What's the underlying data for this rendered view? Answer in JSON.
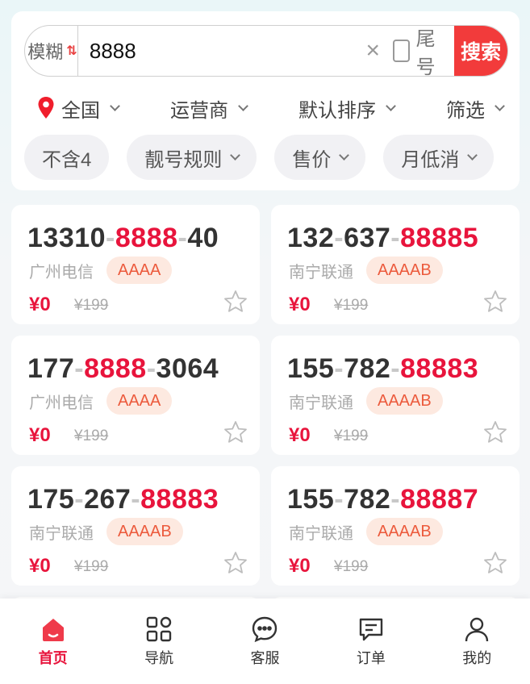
{
  "search": {
    "mode_label": "模糊",
    "swap_glyph": "⇅",
    "value": "8888",
    "clear_glyph": "×",
    "tail_label": "尾号",
    "button_label": "搜索"
  },
  "filters": {
    "region": "全国",
    "carrier": "运营商",
    "sort": "默认排序",
    "screen": "筛选"
  },
  "chips": [
    "不含4",
    "靓号规则",
    "售价",
    "月低消"
  ],
  "numbers": [
    {
      "parts": [
        [
          "13310",
          0
        ],
        [
          "-",
          2
        ],
        [
          "8888",
          1
        ],
        [
          "-",
          2
        ],
        [
          "40",
          0
        ]
      ],
      "location": "广州电信",
      "tag": "AAAA",
      "price": "¥0",
      "original": "¥199"
    },
    {
      "parts": [
        [
          "132",
          0
        ],
        [
          "-",
          2
        ],
        [
          "637",
          0
        ],
        [
          "-",
          2
        ],
        [
          "88885",
          3
        ]
      ],
      "location": "南宁联通",
      "tag": "AAAAB",
      "price": "¥0",
      "original": "¥199"
    },
    {
      "parts": [
        [
          "177",
          0
        ],
        [
          "-",
          2
        ],
        [
          "8888",
          1
        ],
        [
          "-",
          2
        ],
        [
          "3064",
          0
        ]
      ],
      "location": "广州电信",
      "tag": "AAAA",
      "price": "¥0",
      "original": "¥199"
    },
    {
      "parts": [
        [
          "155",
          0
        ],
        [
          "-",
          2
        ],
        [
          "782",
          0
        ],
        [
          "-",
          2
        ],
        [
          "88883",
          3
        ]
      ],
      "location": "南宁联通",
      "tag": "AAAAB",
      "price": "¥0",
      "original": "¥199"
    },
    {
      "parts": [
        [
          "175",
          0
        ],
        [
          "-",
          2
        ],
        [
          "267",
          0
        ],
        [
          "-",
          2
        ],
        [
          "88883",
          3
        ]
      ],
      "location": "南宁联通",
      "tag": "AAAAB",
      "price": "¥0",
      "original": "¥199"
    },
    {
      "parts": [
        [
          "155",
          0
        ],
        [
          "-",
          2
        ],
        [
          "782",
          0
        ],
        [
          "-",
          2
        ],
        [
          "88887",
          3
        ]
      ],
      "location": "南宁联通",
      "tag": "AAAAB",
      "price": "¥0",
      "original": "¥199"
    }
  ],
  "tabs": [
    {
      "label": "首页",
      "icon": "home-icon",
      "active": true
    },
    {
      "label": "导航",
      "icon": "grid-icon",
      "active": false
    },
    {
      "label": "客服",
      "icon": "chat-icon",
      "active": false
    },
    {
      "label": "订单",
      "icon": "order-icon",
      "active": false
    },
    {
      "label": "我的",
      "icon": "user-icon",
      "active": false
    }
  ],
  "colors": {
    "accent": "#e8143c",
    "search_button": "#f23b3b",
    "tag_bg": "#fde9e0",
    "tag_text": "#ec5a3c"
  }
}
